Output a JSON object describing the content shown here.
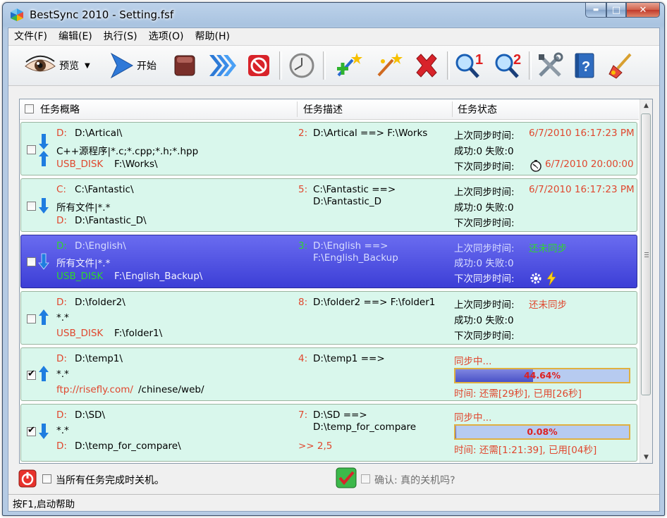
{
  "window": {
    "title": "BestSync 2010 - Setting.fsf",
    "min_glyph": "▬",
    "max_glyph": "□",
    "close_glyph": "✕"
  },
  "menu": [
    "文件(F)",
    "编辑(E)",
    "执行(S)",
    "选项(O)",
    "帮助(H)"
  ],
  "toolbar": {
    "preview_label": "预览",
    "start_label": "开始"
  },
  "columns": {
    "summary": "任务概略",
    "description": "任务描述",
    "status": "任务状态"
  },
  "tasks": [
    {
      "checked": false,
      "direction": "both",
      "src_prefix": "D:",
      "src_path": "D:\\Artical\\",
      "filter": "C++源程序|*.c;*.cpp;*.h;*.hpp",
      "dst_prefix": "USB_DISK",
      "dst_path": "F:\\Works\\",
      "num": "2:",
      "desc1": "D:\\Artical ==> F:\\Works",
      "desc2": "",
      "last_label": "上次同步时间:",
      "last_value": "6/7/2010 16:17:23 PM",
      "result": "成功:0 失败:0",
      "next_label": "下次同步时间:",
      "next_value": "6/7/2010 20:00:00"
    },
    {
      "checked": false,
      "direction": "down",
      "src_prefix": "C:",
      "src_path": "C:\\Fantastic\\",
      "filter": "所有文件|*.*",
      "dst_prefix": "D:",
      "dst_path": "D:\\Fantastic_D\\",
      "num": "5:",
      "desc1": "C:\\Fantastic ==>",
      "desc2": "D:\\Fantastic_D",
      "last_label": "上次同步时间:",
      "last_value": "6/7/2010 16:17:23 PM",
      "result": "成功:0 失败:0",
      "next_label": "下次同步时间:",
      "next_value": ""
    },
    {
      "checked": false,
      "direction": "down",
      "selected": true,
      "src_prefix": "D:",
      "src_path": "D:\\English\\",
      "filter": "所有文件|*.*",
      "dst_prefix": "USB_DISK",
      "dst_path": "F:\\English_Backup\\",
      "num": "3:",
      "desc1": "D:\\English ==>",
      "desc2": "F:\\English_Backup",
      "last_label": "上次同步时间:",
      "last_value": "还未同步",
      "result": "成功:0 失败:0",
      "next_label": "下次同步时间:",
      "next_value": ""
    },
    {
      "checked": false,
      "direction": "up",
      "src_prefix": "D:",
      "src_path": "D:\\folder2\\",
      "filter": "*.*",
      "dst_prefix": "USB_DISK",
      "dst_path": "F:\\folder1\\",
      "num": "8:",
      "desc1": "D:\\folder2 ==> F:\\folder1",
      "desc2": "",
      "last_label": "上次同步时间:",
      "last_value": "还未同步",
      "result": "成功:0 失败:0",
      "next_label": "下次同步时间:",
      "next_value": ""
    },
    {
      "checked": true,
      "direction": "up",
      "src_prefix": "D:",
      "src_path": "D:\\temp1\\",
      "filter": "*.*",
      "dst_prefix": "ftp://risefly.com/",
      "dst_path": "/chinese/web/",
      "num": "4:",
      "desc1": "D:\\temp1 ==>",
      "desc2": "",
      "syncing": "同步中...",
      "progress_text": "44.64%",
      "progress": 0.4464,
      "time": "时间: 还需[29秒], 已用[26秒]"
    },
    {
      "checked": true,
      "direction": "down",
      "src_prefix": "D:",
      "src_path": "D:\\SD\\",
      "filter": "*.*",
      "dst_prefix": "D:",
      "dst_path": "D:\\temp_for_compare\\",
      "num": "7:",
      "desc1": "D:\\SD ==>",
      "desc2": "D:\\temp_for_compare",
      "extra": ">> 2,5",
      "syncing": "同步中...",
      "progress_text": "0.08%",
      "progress": 0.0008,
      "time": "时间: 还需[1:21:39], 已用[04秒]"
    }
  ],
  "bottom": {
    "shutdown_label": "当所有任务完成时关机。",
    "confirm_label": "确认: 真的关机吗?"
  },
  "status": "按F1,启动帮助",
  "colors": {
    "accent_red": "#e0472e",
    "selected_row": "#3c3ed6",
    "row_bg": "#d9f7ec",
    "green": "#2fd62f"
  }
}
